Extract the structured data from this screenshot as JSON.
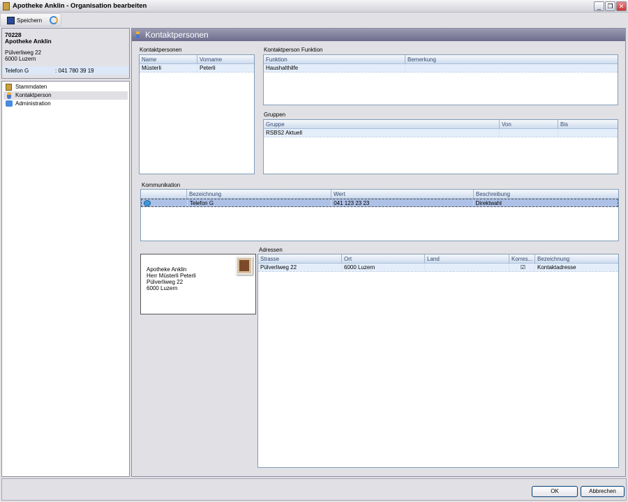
{
  "window": {
    "title": "Apotheke Anklin - Organisation bearbeiten",
    "minimize": "_",
    "restore": "❐",
    "close": "✕"
  },
  "toolbar": {
    "save_label": "Speichern"
  },
  "info": {
    "number": "70228",
    "name": "Apotheke Anklin",
    "street": "Pülverliweg 22",
    "city": "6000 Luzern",
    "phone_label": "Telefon G",
    "phone_value": ": 041 780 39 19"
  },
  "nav": {
    "items": [
      {
        "label": "Stammdaten",
        "icon": "building-icon"
      },
      {
        "label": "Kontaktperson",
        "icon": "person-icon"
      },
      {
        "label": "Administration",
        "icon": "admin-icon"
      }
    ]
  },
  "main": {
    "title": "Kontaktpersonen",
    "kontaktpersonen": {
      "label": "Kontaktpersonen",
      "columns": [
        "Name",
        "Vorname"
      ],
      "rows": [
        [
          "Müsterli",
          "Peterli"
        ]
      ]
    },
    "funktion": {
      "label": "Kontaktperson Funktion",
      "columns": [
        "Funktion",
        "Bemerkung"
      ],
      "rows": [
        [
          "Haushalthilfe",
          ""
        ]
      ]
    },
    "gruppen": {
      "label": "Gruppen",
      "columns": [
        "Gruppe",
        "Von",
        "Bis"
      ],
      "rows": [
        [
          "RSBS2 Aktuell",
          "",
          ""
        ]
      ]
    },
    "kommunikation": {
      "label": "Kommunikation",
      "columns": [
        "",
        "Bezeichnung",
        "Wert",
        "Beschreibung"
      ],
      "rows": [
        [
          "",
          "Telefon G",
          "041 123 23 23",
          "Direktwahl"
        ]
      ]
    },
    "adressen": {
      "label": "Adressen",
      "columns": [
        "Strasse",
        "Ort",
        "Land",
        "Korres...",
        "Bezeichnung"
      ],
      "rows": [
        [
          "Pülverliweg 22",
          "6000 Luzern",
          "",
          "☑",
          "Kontaktadresse"
        ]
      ]
    },
    "card": {
      "lines": [
        "Apotheke Anklin",
        "Herr Müsterli Peterli",
        "Pülverliweg 22",
        "6000 Luzern"
      ]
    }
  },
  "buttons": {
    "ok": "OK",
    "cancel": "Abbrechen"
  },
  "colors": {
    "header": "#6d6d8c",
    "selection": "#adc0e6",
    "grid_border": "#7f9db9"
  }
}
